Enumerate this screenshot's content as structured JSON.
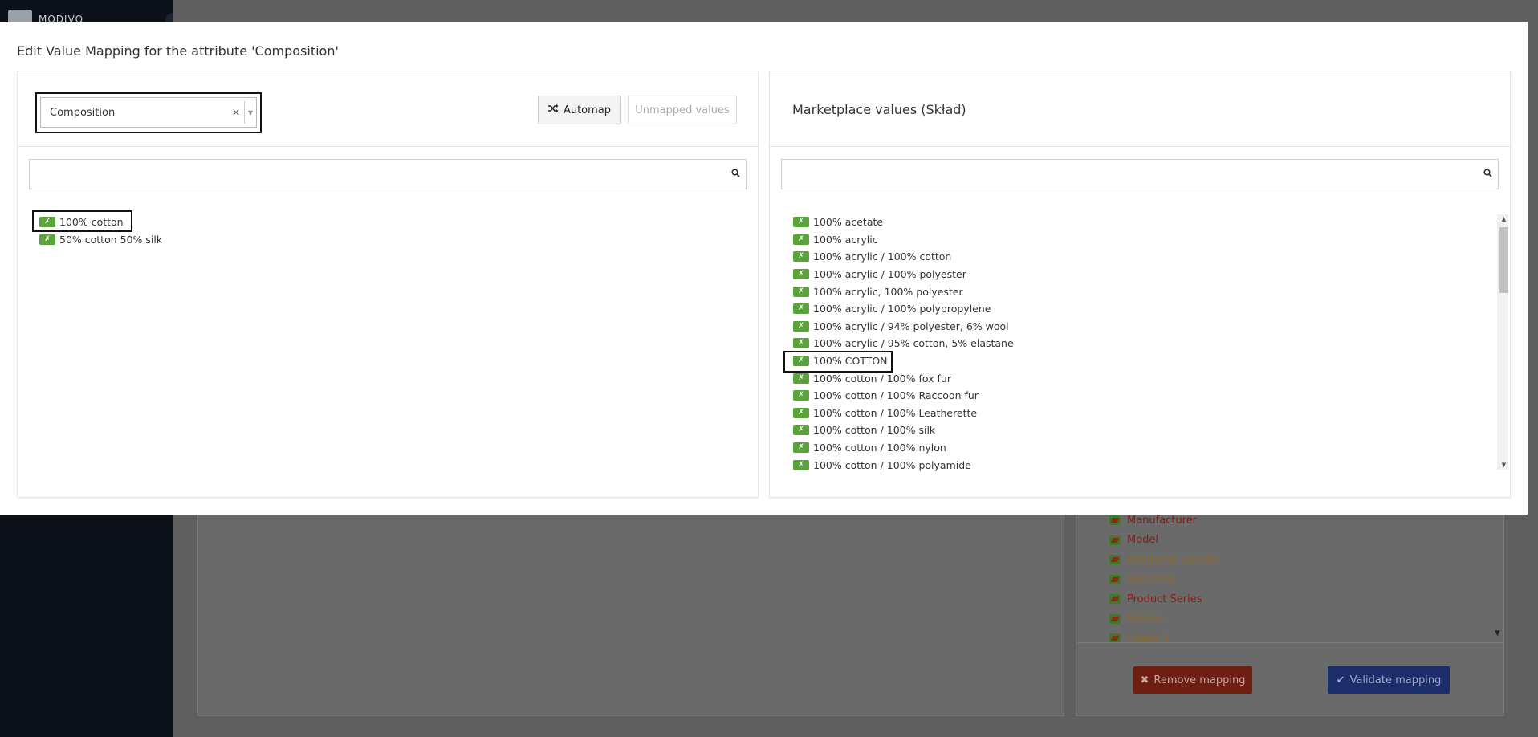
{
  "background": {
    "brand": "MODIVO",
    "attributes": [
      {
        "label": "Manufacturer",
        "tone": "red"
      },
      {
        "label": "Model",
        "tone": "red"
      },
      {
        "label": "Additional gender",
        "tone": "orange"
      },
      {
        "label": "Grouping",
        "tone": "orange"
      },
      {
        "label": "Product Series",
        "tone": "red"
      },
      {
        "label": "Season",
        "tone": "orange"
      },
      {
        "label": "Image 1",
        "tone": "orange"
      }
    ],
    "remove_label": "Remove mapping",
    "validate_label": "Validate mapping"
  },
  "modal": {
    "title": "Edit Value Mapping for the attribute 'Composition'"
  },
  "left_panel": {
    "select_value": "Composition",
    "automap_label": "Automap",
    "unmapped_label": "Unmapped values",
    "search_value": "",
    "values": [
      "100% cotton",
      "50% cotton 50% silk"
    ]
  },
  "right_panel": {
    "heading": "Marketplace values (Skład)",
    "search_value": "",
    "values": [
      "100% acetate",
      "100% acrylic",
      "100% acrylic / 100% cotton",
      "100% acrylic / 100% polyester",
      "100% acrylic, 100% polyester",
      "100% acrylic / 100% polypropylene",
      "100% acrylic / 94% polyester, 6% wool",
      "100% acrylic / 95% cotton, 5% elastane",
      "100% COTTON",
      "100% cotton / 100% fox fur",
      "100% cotton / 100% Raccoon fur",
      "100% cotton / 100% Leatherette",
      "100% cotton / 100% silk",
      "100% cotton / 100% nylon",
      "100% cotton / 100% polyamide"
    ]
  },
  "colors": {
    "badge_green": "#5aa33b",
    "highlight_border": "#111111"
  }
}
